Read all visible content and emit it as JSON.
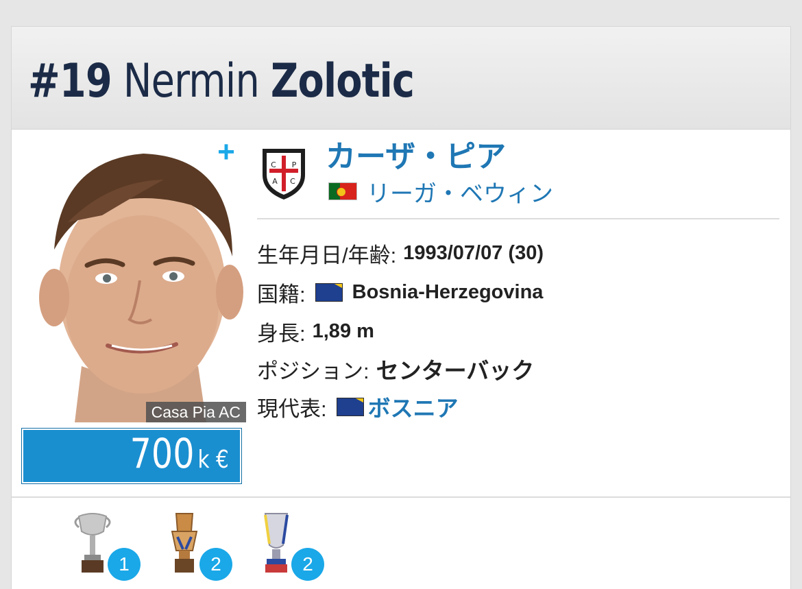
{
  "player": {
    "number": "#19",
    "first_name": "Nermin",
    "last_name": "Zolotic"
  },
  "photo": {
    "caption": "Casa Pia AC"
  },
  "market_value": {
    "amount": "700",
    "unit": "k €",
    "color": "#1a8fd0"
  },
  "actions": {
    "add_label": "+"
  },
  "club": {
    "name": "カーザ・ピア",
    "badge_icon": "casa-pia-crest-icon",
    "league": "リーガ・ベウィン",
    "league_flag_icon": "portugal-flag-icon"
  },
  "details": {
    "birth_label": "生年月日/年齢:",
    "birth_value": "1993/07/07 (30)",
    "nationality_label": "国籍:",
    "nationality_value": "Bosnia-Herzegovina",
    "nationality_flag_icon": "bosnia-flag-icon",
    "height_label": "身長:",
    "height_value": "1,89 m",
    "position_label": "ポジション:",
    "position_value": "センターバック",
    "national_team_label": "現代表:",
    "national_team_value": "ボスニア"
  },
  "trophies": [
    {
      "icon": "cup-trophy-icon",
      "count": "1"
    },
    {
      "icon": "league-trophy-icon",
      "count": "2"
    },
    {
      "icon": "super-cup-trophy-icon",
      "count": "2"
    }
  ],
  "colors": {
    "link": "#1f77b4",
    "accent": "#1aa8e8",
    "title": "#1b2b47"
  }
}
